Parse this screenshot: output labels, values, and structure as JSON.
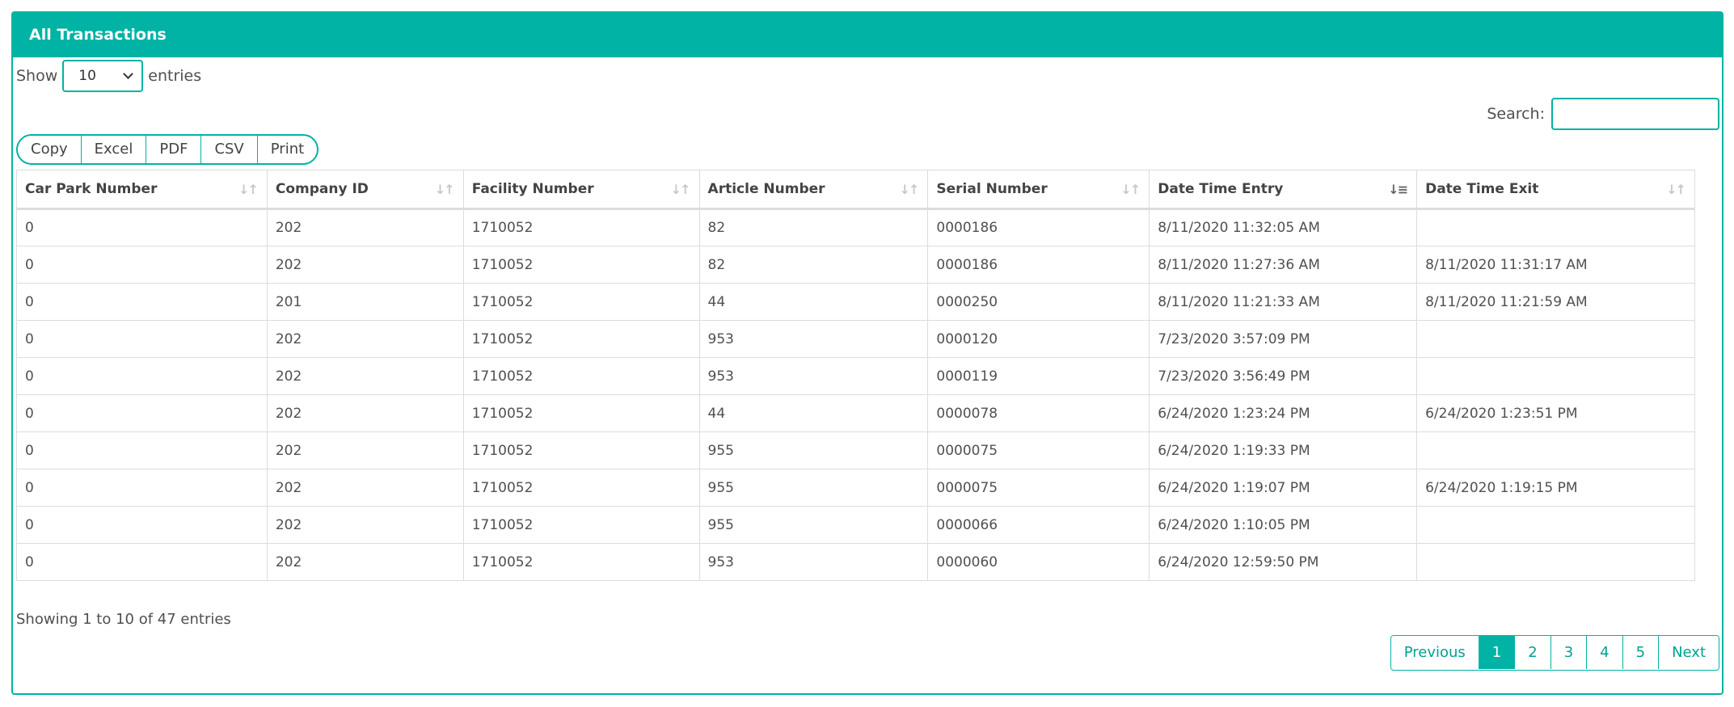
{
  "panel": {
    "title": "All Transactions"
  },
  "length": {
    "show_label": "Show",
    "value": "10",
    "entries_label": "entries"
  },
  "search": {
    "label": "Search:",
    "value": ""
  },
  "buttons": [
    "Copy",
    "Excel",
    "PDF",
    "CSV",
    "Print"
  ],
  "table": {
    "columns": [
      "Car Park Number",
      "Company ID",
      "Facility Number",
      "Article Number",
      "Serial Number",
      "Date Time Entry",
      "Date Time Exit"
    ],
    "sorted_column": "Date Time Entry",
    "rows": [
      [
        "0",
        "202",
        "1710052",
        "82",
        "0000186",
        "8/11/2020 11:32:05 AM",
        ""
      ],
      [
        "0",
        "202",
        "1710052",
        "82",
        "0000186",
        "8/11/2020 11:27:36 AM",
        "8/11/2020 11:31:17 AM"
      ],
      [
        "0",
        "201",
        "1710052",
        "44",
        "0000250",
        "8/11/2020 11:21:33 AM",
        "8/11/2020 11:21:59 AM"
      ],
      [
        "0",
        "202",
        "1710052",
        "953",
        "0000120",
        "7/23/2020 3:57:09 PM",
        ""
      ],
      [
        "0",
        "202",
        "1710052",
        "953",
        "0000119",
        "7/23/2020 3:56:49 PM",
        ""
      ],
      [
        "0",
        "202",
        "1710052",
        "44",
        "0000078",
        "6/24/2020 1:23:24 PM",
        "6/24/2020 1:23:51 PM"
      ],
      [
        "0",
        "202",
        "1710052",
        "955",
        "0000075",
        "6/24/2020 1:19:33 PM",
        ""
      ],
      [
        "0",
        "202",
        "1710052",
        "955",
        "0000075",
        "6/24/2020 1:19:07 PM",
        "6/24/2020 1:19:15 PM"
      ],
      [
        "0",
        "202",
        "1710052",
        "955",
        "0000066",
        "6/24/2020 1:10:05 PM",
        ""
      ],
      [
        "0",
        "202",
        "1710052",
        "953",
        "0000060",
        "6/24/2020 12:59:50 PM",
        ""
      ]
    ]
  },
  "info": "Showing 1 to 10 of 47 entries",
  "pagination": {
    "previous": "Previous",
    "pages": [
      "1",
      "2",
      "3",
      "4",
      "5"
    ],
    "active": "1",
    "next": "Next"
  },
  "colors": {
    "accent": "#00b3a4",
    "border": "#dcdcdc",
    "text": "#505050"
  }
}
